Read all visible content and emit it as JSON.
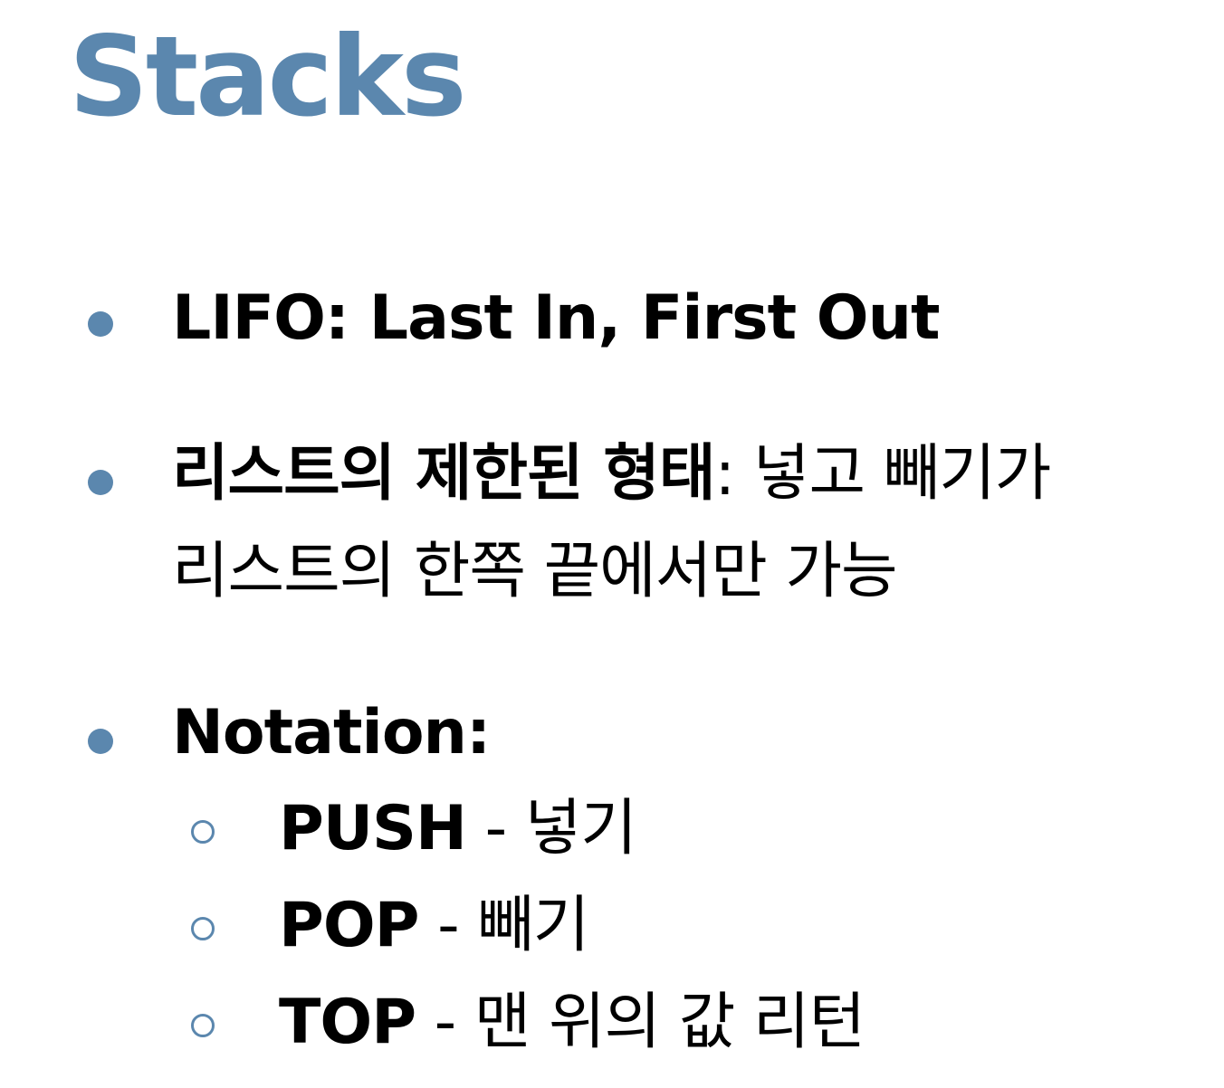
{
  "colors": {
    "accent": "#5b87ae",
    "text": "#000000",
    "background": "#ffffff"
  },
  "slide": {
    "title": "Stacks",
    "bullets": [
      {
        "bold": "LIFO: Last In, First Out",
        "normal": ""
      },
      {
        "bold": "리스트의 제한된 형태",
        "normal": ": 넣고 빼기가",
        "continuation": "리스트의 한쪽 끝에서만 가능"
      },
      {
        "bold": "Notation:",
        "normal": "",
        "sub_items": [
          {
            "bold": "PUSH",
            "normal": " - 넣기"
          },
          {
            "bold": "POP",
            "normal": " - 빼기"
          },
          {
            "bold": "TOP",
            "normal": " - 맨 위의 값 리턴"
          }
        ]
      }
    ]
  }
}
